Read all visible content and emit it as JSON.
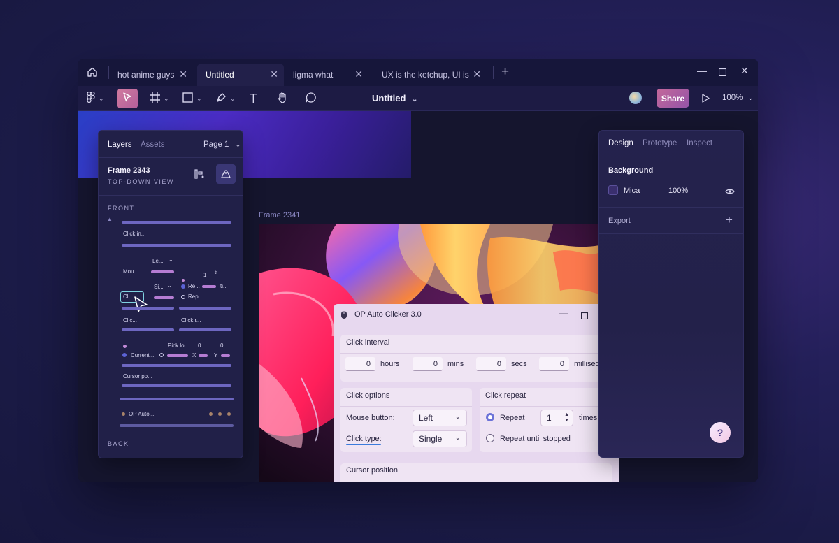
{
  "tabs": [
    {
      "label": "hot anime guys",
      "active": false
    },
    {
      "label": "Untitled",
      "active": true
    },
    {
      "label": "ligma what",
      "active": false
    },
    {
      "label": "UX is the ketchup, UI is the",
      "active": false
    }
  ],
  "toolbar": {
    "document_title": "Untitled",
    "share_label": "Share",
    "zoom": "100%",
    "text_tool": "T"
  },
  "canvas": {
    "frame_label": "Frame 2341"
  },
  "layers_panel": {
    "tabs": {
      "layers": "Layers",
      "assets": "Assets"
    },
    "page": "Page 1",
    "frame_name": "Frame 2343",
    "view_label": "TOP-DOWN VIEW",
    "front_label": "FRONT",
    "back_label": "BACK",
    "items": {
      "click_interval": "Click in...",
      "mouse": "Mou...",
      "left": "Le...",
      "single": "Si...",
      "repeat_value": "1",
      "repeat": "Re...",
      "times": "ti...",
      "repeat_until": "Rep...",
      "click_options": "Cl...",
      "click_options2": "Clic...",
      "click_repeat": "Click r...",
      "pick_location": "Pick lo...",
      "x_value": "0",
      "y_value": "0",
      "current": "Current...",
      "x_label": "X",
      "y_label": "Y",
      "cursor_position": "Cursor po...",
      "op_auto": "OP Auto..."
    }
  },
  "design_panel": {
    "tabs": {
      "design": "Design",
      "prototype": "Prototype",
      "inspect": "Inspect"
    },
    "background_label": "Background",
    "fill_name": "Mica",
    "fill_opacity": "100%",
    "export_label": "Export",
    "help": "?"
  },
  "auto_clicker": {
    "title": "OP Auto Clicker 3.0",
    "click_interval": {
      "label": "Click interval",
      "fields": [
        {
          "value": "0",
          "unit": "hours"
        },
        {
          "value": "0",
          "unit": "mins"
        },
        {
          "value": "0",
          "unit": "secs"
        },
        {
          "value": "0",
          "unit": "millised"
        }
      ]
    },
    "click_options": {
      "label": "Click options",
      "mouse_button_label": "Mouse button:",
      "mouse_button_value": "Left",
      "click_type_label": "Click type:",
      "click_type_value": "Single"
    },
    "click_repeat": {
      "label": "Click repeat",
      "repeat_label": "Repeat",
      "repeat_value": "1",
      "times_label": "times",
      "until_stopped_label": "Repeat until stopped"
    },
    "cursor_position_label": "Cursor position"
  },
  "colors": {
    "accent": "#c4689a",
    "window_bg": "#13132b",
    "panel_bg": "#212048"
  }
}
